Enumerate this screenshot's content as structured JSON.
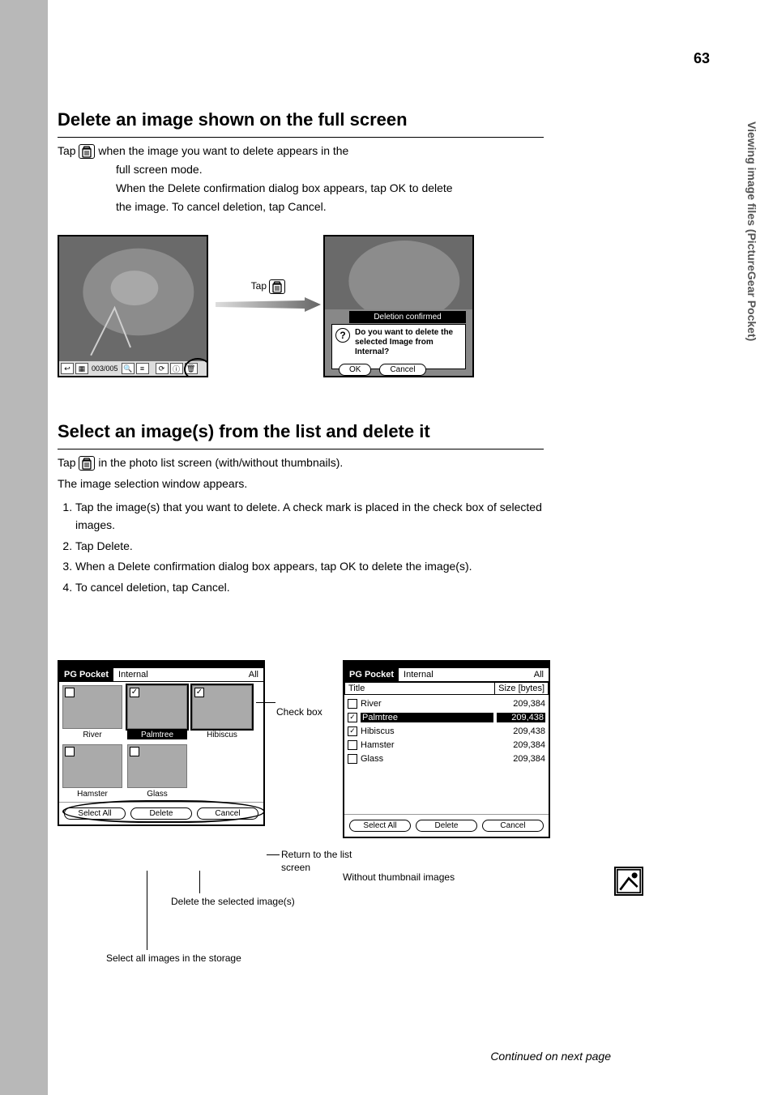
{
  "page": {
    "number": "63",
    "side_tab": "Viewing image files (PictureGear Pocket)",
    "continued": "Continued on next page"
  },
  "sectionA": {
    "title": "Delete an image shown on the full screen",
    "step_prefix": "Tap ",
    "step_suffix": " when the image you want to delete appears in the",
    "step_line2": "full screen mode.",
    "step_sub": "When the Delete confirmation dialog box appears, tap OK to delete",
    "step_sub2": "the image. To cancel deletion, tap Cancel.",
    "toolbar": {
      "counter": "003/005"
    },
    "arrow": {
      "label_prefix": "Tap "
    },
    "dialog": {
      "title": "Deletion confirmed",
      "message": "Do you want to delete the selected Image from Internal?",
      "ok": "OK",
      "cancel": "Cancel"
    }
  },
  "sectionB": {
    "title": "Select an image(s) from the list and delete it",
    "intro_prefix": "Tap ",
    "intro_suffix": " in the photo list screen (with/without thumbnails).",
    "intro_line2": "The image selection window appears.",
    "steps": [
      "Tap the image(s) that you want to delete. A check mark is placed in the check box of selected images.",
      "Tap Delete.",
      "When a Delete confirmation dialog box appears, tap OK to delete the image(s).",
      "To cancel deletion, tap Cancel."
    ]
  },
  "listshot": {
    "app": "PG Pocket",
    "location": "Internal",
    "category": "All",
    "thumbs": [
      {
        "name": "River"
      },
      {
        "name": "Palmtree"
      },
      {
        "name": "Hibiscus"
      },
      {
        "name": "Hamster"
      },
      {
        "name": "Glass"
      }
    ],
    "buttons": {
      "select_all": "Select All",
      "delete": "Delete",
      "cancel": "Cancel"
    },
    "callouts": {
      "checkbox": "Check box",
      "cancel": "Return to the list screen",
      "delete": "Delete the selected image(s)",
      "select_all": "Select all images in the storage"
    }
  },
  "detailshot": {
    "columns": {
      "title": "Title",
      "size": "Size [bytes]"
    },
    "rows": [
      {
        "name": "River",
        "size": "209,384"
      },
      {
        "name": "Palmtree",
        "size": "209,438"
      },
      {
        "name": "Hibiscus",
        "size": "209,438"
      },
      {
        "name": "Hamster",
        "size": "209,384"
      },
      {
        "name": "Glass",
        "size": "209,384"
      }
    ],
    "caption": "Without thumbnail images"
  }
}
